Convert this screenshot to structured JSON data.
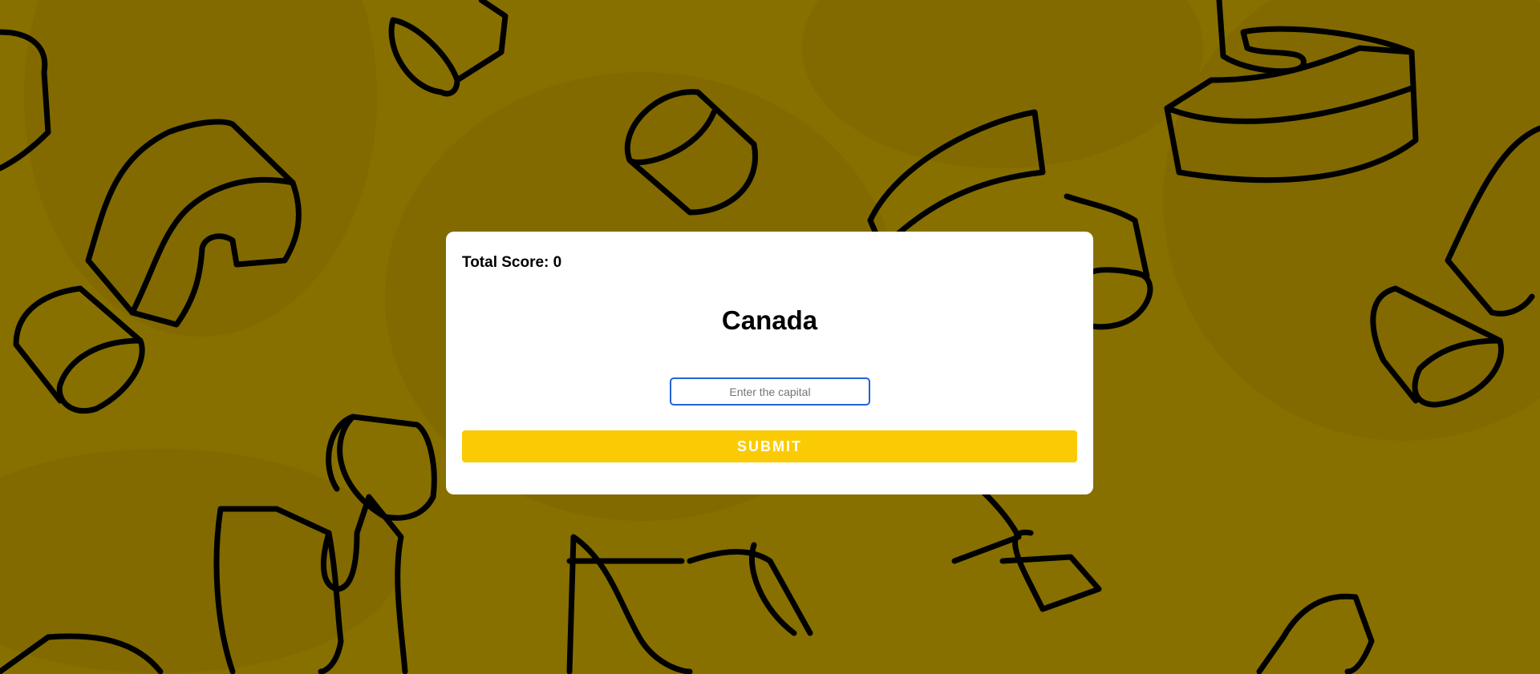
{
  "colors": {
    "background": "#877000",
    "accent": "#facb05",
    "input_border": "#2264d1"
  },
  "quiz": {
    "score_label": "Total Score: 0",
    "country": "Canada",
    "input_placeholder": "Enter the capital",
    "input_value": "",
    "submit_label": "SUBMIT"
  }
}
